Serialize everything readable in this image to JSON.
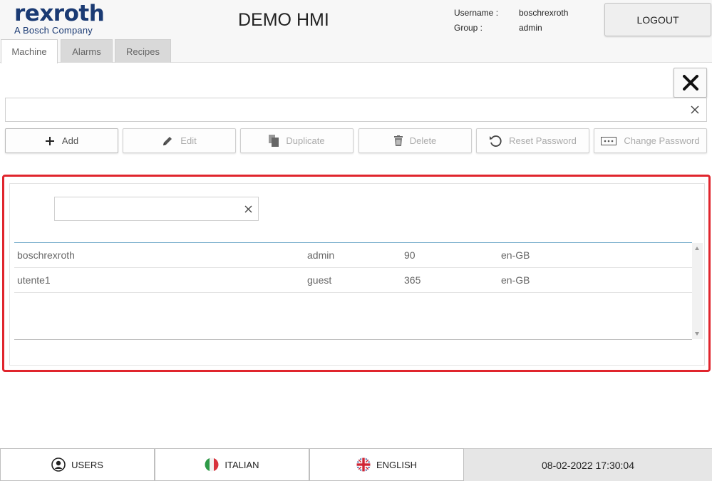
{
  "header": {
    "logo_main": "rexroth",
    "logo_sub": "A Bosch Company",
    "title": "DEMO HMI",
    "username_label": "Username :",
    "username_value": "boschrexroth",
    "group_label": "Group :",
    "group_value": "admin",
    "logout_label": "LOGOUT"
  },
  "tabs": [
    {
      "label": "Machine",
      "active": true
    },
    {
      "label": "Alarms",
      "active": false
    },
    {
      "label": "Recipes",
      "active": false
    }
  ],
  "search": {
    "value": "",
    "placeholder": ""
  },
  "toolbar": {
    "add": "Add",
    "edit": "Edit",
    "duplicate": "Duplicate",
    "delete": "Delete",
    "reset_password": "Reset Password",
    "change_password": "Change Password"
  },
  "users_panel": {
    "filter_value": "",
    "rows": [
      {
        "name": "boschrexroth",
        "group": "admin",
        "days": "90",
        "language": "en-GB"
      },
      {
        "name": "utente1",
        "group": "guest",
        "days": "365",
        "language": "en-GB"
      }
    ]
  },
  "footer": {
    "users": "USERS",
    "italian": "ITALIAN",
    "english": "ENGLISH",
    "datetime": "08-02-2022 17:30:04"
  },
  "colors": {
    "brand": "#1a3a73",
    "highlight": "#e0252d"
  }
}
